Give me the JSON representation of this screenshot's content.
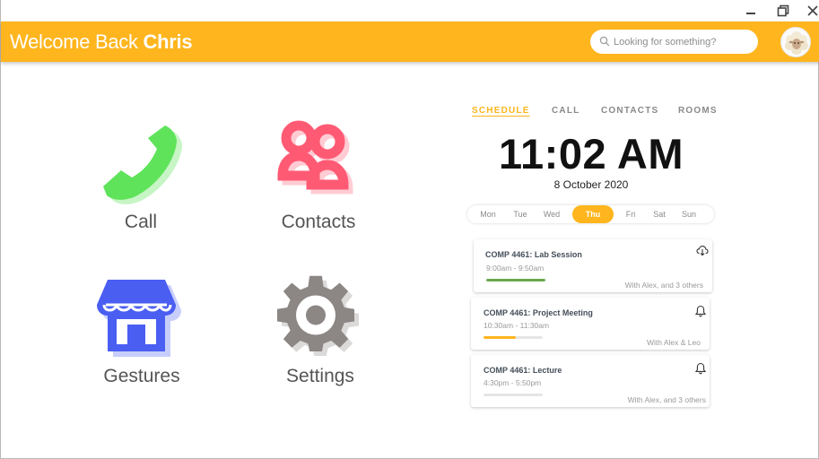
{
  "header": {
    "welcome_prefix": "Welcome Back ",
    "user_name": "Chris",
    "search_placeholder": "Looking for something?"
  },
  "tiles": [
    {
      "label": "Call",
      "icon": "phone-icon",
      "color": "#5fe35a"
    },
    {
      "label": "Contacts",
      "icon": "contacts-icon",
      "color": "#ff5a74"
    },
    {
      "label": "Gestures",
      "icon": "store-icon",
      "color": "#4a5ef2"
    },
    {
      "label": "Settings",
      "icon": "gear-icon",
      "color": "#8c8685"
    }
  ],
  "tabs": [
    {
      "label": "SCHEDULE",
      "active": true
    },
    {
      "label": "CALL",
      "active": false
    },
    {
      "label": "CONTACTS",
      "active": false
    },
    {
      "label": "ROOMS",
      "active": false
    }
  ],
  "clock": {
    "time": "11:02 AM",
    "date": "8 October 2020"
  },
  "days": [
    {
      "label": "Mon"
    },
    {
      "label": "Tue"
    },
    {
      "label": "Wed"
    },
    {
      "label": "Thu",
      "active": true
    },
    {
      "label": "Fri"
    },
    {
      "label": "Sat"
    },
    {
      "label": "Sun"
    }
  ],
  "events": [
    {
      "title": "COMP 4461: Lab Session",
      "time": "9:00am - 9:50am",
      "with": "With Alex, and 3 others",
      "progress": 1.0,
      "progress_color": "#6aa84f",
      "icon": "cloud-download-icon"
    },
    {
      "title": "COMP 4461: Project Meeting",
      "time": "10:30am - 11:30am",
      "with": "With Alex & Leo",
      "progress": 0.55,
      "progress_color": "#ffb51d",
      "icon": "bell-icon"
    },
    {
      "title": "COMP 4461: Lecture",
      "time": "4:30pm - 5:50pm",
      "with": "With Alex, and 3 others",
      "progress": 0.0,
      "progress_color": "#e5e5e5",
      "icon": "bell-icon"
    }
  ],
  "colors": {
    "accent": "#ffb51d",
    "header_text": "#ffffff"
  }
}
